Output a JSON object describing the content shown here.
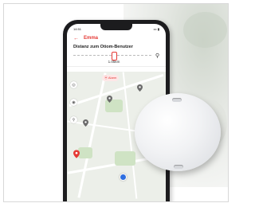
{
  "status_bar": {
    "time": "14:51",
    "indicators": "••• ▮"
  },
  "nav": {
    "back_icon": "arrow-left-icon",
    "title": "Emma"
  },
  "distance": {
    "title": "Distanz zum Otiom-Benutzer",
    "value": "1.05km"
  },
  "map": {
    "alarm_chip": "Alarm"
  },
  "colors": {
    "accent": "#e53935",
    "location": "#2f6fe0",
    "device": "#f1f2f4"
  }
}
